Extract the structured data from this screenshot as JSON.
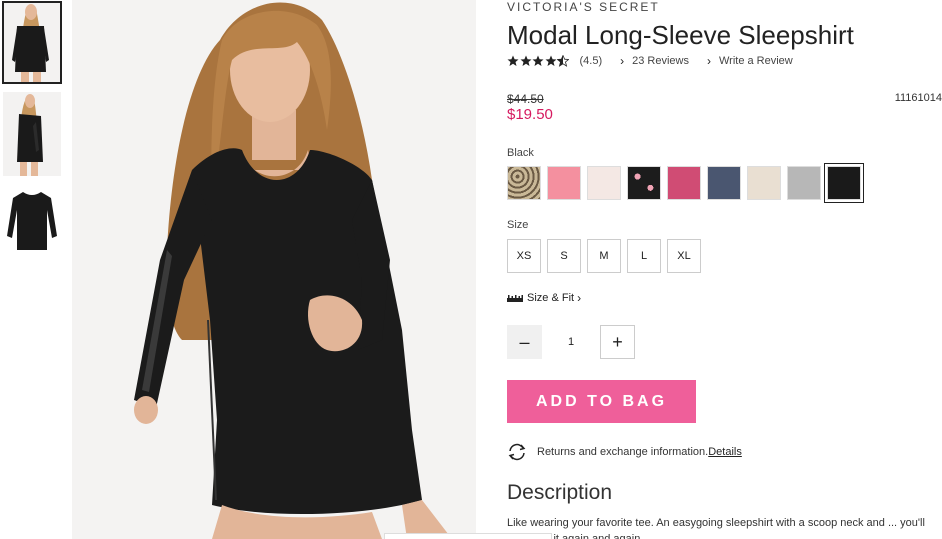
{
  "brand": "VICTORIA'S SECRET",
  "product": {
    "title": "Modal Long-Sleeve Sleepshirt",
    "rating_display": "(4.5)",
    "rating_value": 4.5,
    "reviews_link": "23 Reviews",
    "write_review_link": "Write a Review",
    "original_price": "$44.50",
    "sale_price": "$19.50",
    "item_number": "11161014"
  },
  "color": {
    "label": "Black",
    "swatches": [
      {
        "name": "leopard",
        "color": "#b8a88e"
      },
      {
        "name": "pink",
        "color": "#f4909f"
      },
      {
        "name": "blush",
        "color": "#f4e8e4"
      },
      {
        "name": "black-floral",
        "color": "#1c1c1c"
      },
      {
        "name": "pink-heather",
        "color": "#d04c74"
      },
      {
        "name": "navy-heather",
        "color": "#4a5670"
      },
      {
        "name": "oatmeal",
        "color": "#e9dfd2"
      },
      {
        "name": "grey",
        "color": "#b7b7b7"
      },
      {
        "name": "black",
        "color": "#1a1a1a"
      }
    ]
  },
  "size": {
    "label": "Size",
    "options": [
      "XS",
      "S",
      "M",
      "L",
      "XL"
    ],
    "size_fit_link": "Size & Fit"
  },
  "quantity": {
    "value": "1",
    "minus": "–",
    "plus": "+"
  },
  "add_to_bag": "ADD TO BAG",
  "returns": {
    "text": "Returns and exchange information.",
    "link": "Details"
  },
  "description": {
    "title": "Description",
    "text": "Like wearing your favorite tee. An easygoing sleepshirt with a scoop neck and ... you'll reach for it again and again."
  },
  "accent_colors": {
    "sale_price": "#d6195f",
    "add_button": "#ef5f9a"
  }
}
